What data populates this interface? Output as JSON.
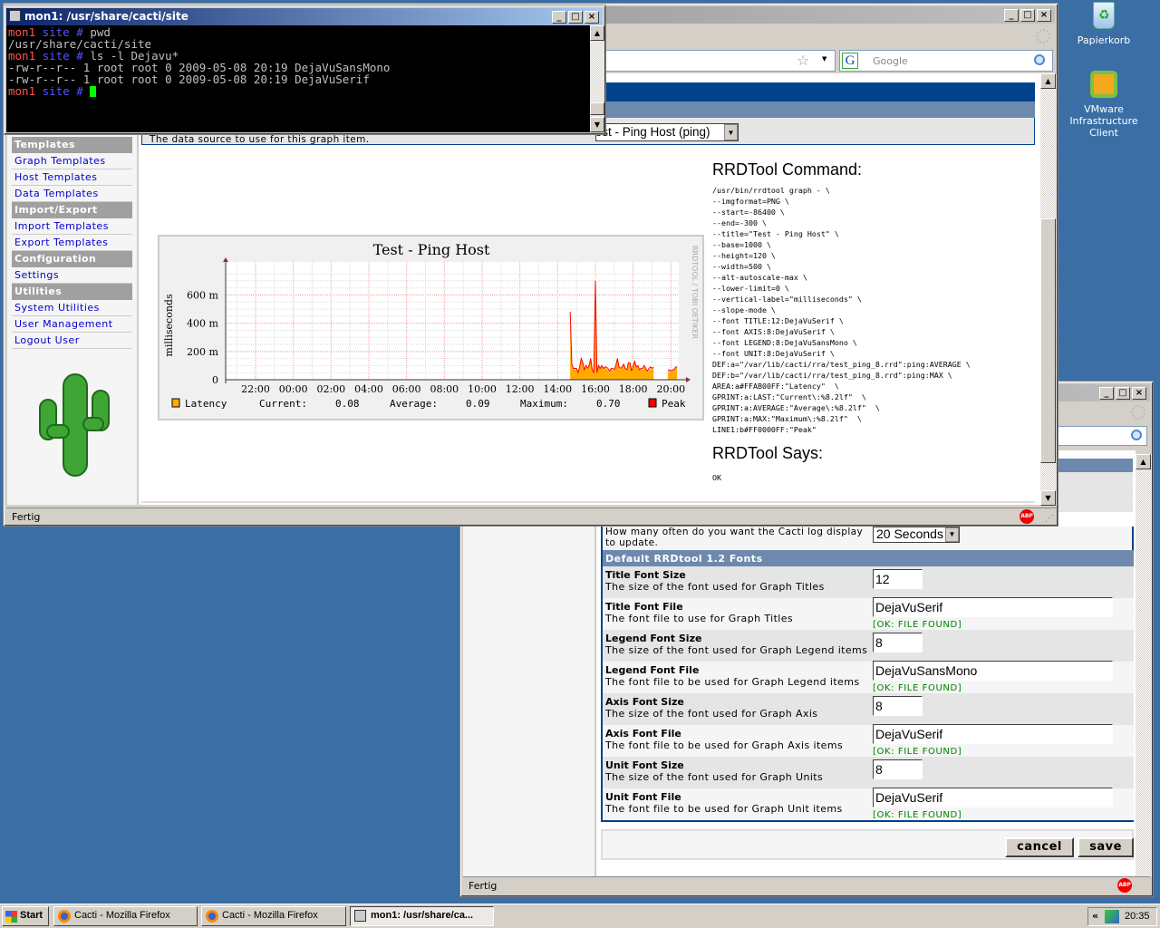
{
  "desktop": {
    "icons": [
      {
        "label": "Papierkorb",
        "icon": "recycle-bin-icon"
      },
      {
        "label": "VMware Infrastructure Client",
        "icon": "vmware-icon"
      }
    ]
  },
  "terminal": {
    "title": "mon1: /usr/share/cacti/site",
    "lines": [
      {
        "host": "mon1",
        "dir": "site",
        "prompt": "#",
        "cmd": "pwd"
      },
      {
        "out": "/usr/share/cacti/site"
      },
      {
        "host": "mon1",
        "dir": "site",
        "prompt": "#",
        "cmd": "ls -l Dejavu*"
      },
      {
        "out": "-rw-r--r-- 1 root root 0 2009-05-08 20:19 DejaVuSansMono"
      },
      {
        "out": "-rw-r--r-- 1 root root 0 2009-05-08 20:19 DejaVuSerif"
      },
      {
        "host": "mon1",
        "dir": "site",
        "prompt": "#",
        "cmd": ""
      }
    ]
  },
  "firefox_front": {
    "search_placeholder": "Google",
    "status": "Fertig",
    "data_source_hint": "The data source to use for this graph item.",
    "data_source_select": "Test - Ping Host (ping)",
    "sidebar": [
      {
        "type": "header",
        "label": "Templates"
      },
      {
        "type": "link",
        "label": "Graph Templates"
      },
      {
        "type": "link",
        "label": "Host Templates"
      },
      {
        "type": "link",
        "label": "Data Templates"
      },
      {
        "type": "header",
        "label": "Import/Export"
      },
      {
        "type": "link",
        "label": "Import Templates"
      },
      {
        "type": "link",
        "label": "Export Templates"
      },
      {
        "type": "header",
        "label": "Configuration"
      },
      {
        "type": "link",
        "label": "Settings"
      },
      {
        "type": "header",
        "label": "Utilities"
      },
      {
        "type": "link",
        "label": "System Utilities"
      },
      {
        "type": "link",
        "label": "User Management"
      },
      {
        "type": "link",
        "label": "Logout User"
      }
    ],
    "rrd_command_title": "RRDTool Command:",
    "rrd_command": "/usr/bin/rrdtool graph - \\\n--imgformat=PNG \\\n--start=-86400 \\\n--end=-300 \\\n--title=\"Test - Ping Host\" \\\n--base=1000 \\\n--height=120 \\\n--width=500 \\\n--alt-autoscale-max \\\n--lower-limit=0 \\\n--vertical-label=\"milliseconds\" \\\n--slope-mode \\\n--font TITLE:12:DejaVuSerif \\\n--font AXIS:8:DejaVuSerif \\\n--font LEGEND:8:DejaVuSansMono \\\n--font UNIT:8:DejaVuSerif \\\nDEF:a=\"/var/lib/cacti/rra/test_ping_8.rrd\":ping:AVERAGE \\\nDEF:b=\"/var/lib/cacti/rra/test_ping_8.rrd\":ping:MAX \\\nAREA:a#FFAB00FF:\"Latency\"  \\\nGPRINT:a:LAST:\"Current\\:%8.2lf\"  \\\nGPRINT:a:AVERAGE:\"Average\\:%8.2lf\"  \\\nGPRINT:a:MAX:\"Maximum\\:%8.2lf\"  \\\nLINE1:b#FF0000FF:\"Peak\"",
    "rrd_says_title": "RRDTool Says:",
    "rrd_says": "OK"
  },
  "chart_data": {
    "type": "area",
    "title": "Test - Ping Host",
    "ylabel": "milliseconds",
    "watermark": "RRDTOOL / TOBI OETIKER",
    "xlim": [
      "20:25",
      "20:20"
    ],
    "ylim": [
      0,
      0.77
    ],
    "yticks": [
      {
        "v": 0,
        "label": "0"
      },
      {
        "v": 0.2,
        "label": "200 m"
      },
      {
        "v": 0.4,
        "label": "400 m"
      },
      {
        "v": 0.6,
        "label": "600 m"
      }
    ],
    "xticks": [
      "22:00",
      "00:00",
      "02:00",
      "04:00",
      "06:00",
      "08:00",
      "10:00",
      "12:00",
      "14:00",
      "16:00",
      "18:00",
      "20:00"
    ],
    "grid": true,
    "colors": {
      "latency": "#FFAB00",
      "peak": "#FF0000"
    },
    "legend": {
      "latency": "Latency",
      "current_label": "Current:",
      "current": "0.08",
      "average_label": "Average:",
      "average": "0.09",
      "maximum_label": "Maximum:",
      "maximum": "0.70",
      "peak": "Peak"
    },
    "x": [
      "14:40",
      "14:45",
      "14:50",
      "14:55",
      "15:00",
      "15:05",
      "15:10",
      "15:15",
      "15:20",
      "15:25",
      "15:30",
      "15:35",
      "15:40",
      "15:45",
      "15:50",
      "15:55",
      "16:00",
      "16:05",
      "16:10",
      "16:15",
      "16:20",
      "16:25",
      "16:30",
      "16:35",
      "16:40",
      "16:45",
      "16:50",
      "16:55",
      "17:00",
      "17:05",
      "17:10",
      "17:15",
      "17:20",
      "17:25",
      "17:30",
      "17:35",
      "17:40",
      "17:45",
      "17:50",
      "17:55",
      "18:00",
      "18:05",
      "18:10",
      "18:15",
      "18:20",
      "18:25",
      "18:30",
      "18:35",
      "18:40",
      "18:45",
      "18:50",
      "18:55",
      "19:00",
      "19:05",
      "19:10",
      "19:50",
      "19:55",
      "20:00",
      "20:05",
      "20:10",
      "20:15",
      "20:20"
    ],
    "series": [
      {
        "name": "Latency",
        "values": [
          0.47,
          0.1,
          0.08,
          0.07,
          0.08,
          0.04,
          0.08,
          0.14,
          0.12,
          0.06,
          0.09,
          0.07,
          0.1,
          0.15,
          0.06,
          0.04,
          0.69,
          0.04,
          0.09,
          0.08,
          0.1,
          0.07,
          0.09,
          0.08,
          0.07,
          0.05,
          0.08,
          0.07,
          0.06,
          0.09,
          0.14,
          0.08,
          0.07,
          0.09,
          0.1,
          0.08,
          0.06,
          0.11,
          0.12,
          0.05,
          0.09,
          0.12,
          0.08,
          0.1,
          0.06,
          0.08,
          0.07,
          0.09,
          0.08,
          0.05,
          0.07,
          0.08,
          0.07,
          0.08,
          null,
          0.05,
          0.06,
          0.05,
          0.07,
          0.06,
          0.09,
          0.08
        ]
      },
      {
        "name": "Peak",
        "values": [
          0.48,
          0.11,
          0.08,
          0.08,
          0.08,
          0.05,
          0.09,
          0.15,
          0.12,
          0.07,
          0.1,
          0.08,
          0.1,
          0.15,
          0.07,
          0.05,
          0.7,
          0.05,
          0.1,
          0.08,
          0.1,
          0.08,
          0.09,
          0.09,
          0.08,
          0.06,
          0.08,
          0.08,
          0.07,
          0.1,
          0.15,
          0.09,
          0.08,
          0.09,
          0.11,
          0.08,
          0.07,
          0.12,
          0.12,
          0.06,
          0.1,
          0.13,
          0.09,
          0.1,
          0.07,
          0.08,
          0.08,
          0.1,
          0.08,
          0.06,
          0.08,
          0.09,
          0.08,
          0.09,
          null,
          0.06,
          0.07,
          0.06,
          0.07,
          0.07,
          0.09,
          0.09
        ]
      }
    ]
  },
  "firefox_back": {
    "search_placeholder": "Google",
    "status": "Fertig",
    "log_desc": "How many often do you want the Cacti log display to update.",
    "log_select": "20 Seconds",
    "section": "Default RRDtool 1.2 Fonts",
    "rows": [
      {
        "title": "Title Font Size",
        "desc": "The size of the font used for Graph Titles",
        "value": "12",
        "type": "size"
      },
      {
        "title": "Title Font File",
        "desc": "The font file to use for Graph Titles",
        "value": "DejaVuSerif",
        "type": "file",
        "status": "[OK: FILE FOUND]"
      },
      {
        "title": "Legend Font Size",
        "desc": "The size of the font used for Graph Legend items",
        "value": "8",
        "type": "size"
      },
      {
        "title": "Legend Font File",
        "desc": "The font file to be used for Graph Legend items",
        "value": "DejaVuSansMono",
        "type": "file",
        "status": "[OK: FILE FOUND]"
      },
      {
        "title": "Axis Font Size",
        "desc": "The size of the font used for Graph Axis",
        "value": "8",
        "type": "size"
      },
      {
        "title": "Axis Font File",
        "desc": "The font file to be used for Graph Axis items",
        "value": "DejaVuSerif",
        "type": "file",
        "status": "[OK: FILE FOUND]"
      },
      {
        "title": "Unit Font Size",
        "desc": "The size of the font used for Graph Units",
        "value": "8",
        "type": "size"
      },
      {
        "title": "Unit Font File",
        "desc": "The font file to be used for Graph Unit items",
        "value": "DejaVuSerif",
        "type": "file",
        "status": "[OK: FILE FOUND]"
      }
    ],
    "cancel": "cancel",
    "save": "save"
  },
  "taskbar": {
    "start": "Start",
    "tasks": [
      "Cacti - Mozilla Firefox",
      "Cacti - Mozilla Firefox",
      "mon1: /usr/share/ca..."
    ],
    "clock": "20:35"
  }
}
